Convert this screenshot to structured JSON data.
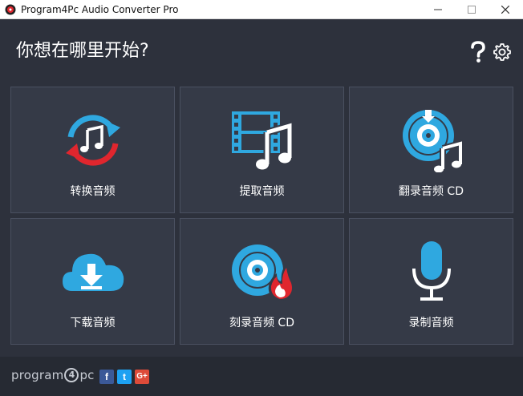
{
  "window": {
    "title": "Program4Pc Audio Converter Pro",
    "icon": "app-disc-icon",
    "controls": [
      "minimize-icon",
      "maximize-icon",
      "close-icon"
    ]
  },
  "main": {
    "heading": "你想在哪里开始?",
    "help_icon": "help-icon",
    "settings_icon": "gear-icon",
    "tiles": [
      {
        "label": "转换音频",
        "icon": "convert-audio-icon"
      },
      {
        "label": "提取音频",
        "icon": "extract-audio-icon"
      },
      {
        "label": "翻录音频 CD",
        "icon": "rip-cd-icon"
      },
      {
        "label": "下载音频",
        "icon": "download-cloud-icon"
      },
      {
        "label": "刻录音频 CD",
        "icon": "burn-cd-icon"
      },
      {
        "label": "录制音频",
        "icon": "microphone-icon"
      }
    ]
  },
  "footer": {
    "logo_prefix": "program",
    "logo_num": "4",
    "logo_suffix": "pc",
    "social": [
      {
        "label": "f",
        "icon": "facebook-icon"
      },
      {
        "label": "t",
        "icon": "twitter-icon"
      },
      {
        "label": "G+",
        "icon": "google-plus-icon"
      }
    ]
  },
  "colors": {
    "accent": "#2fa8e0",
    "red": "#e0262e",
    "background": "#2d313c",
    "tile": "#353a47"
  }
}
